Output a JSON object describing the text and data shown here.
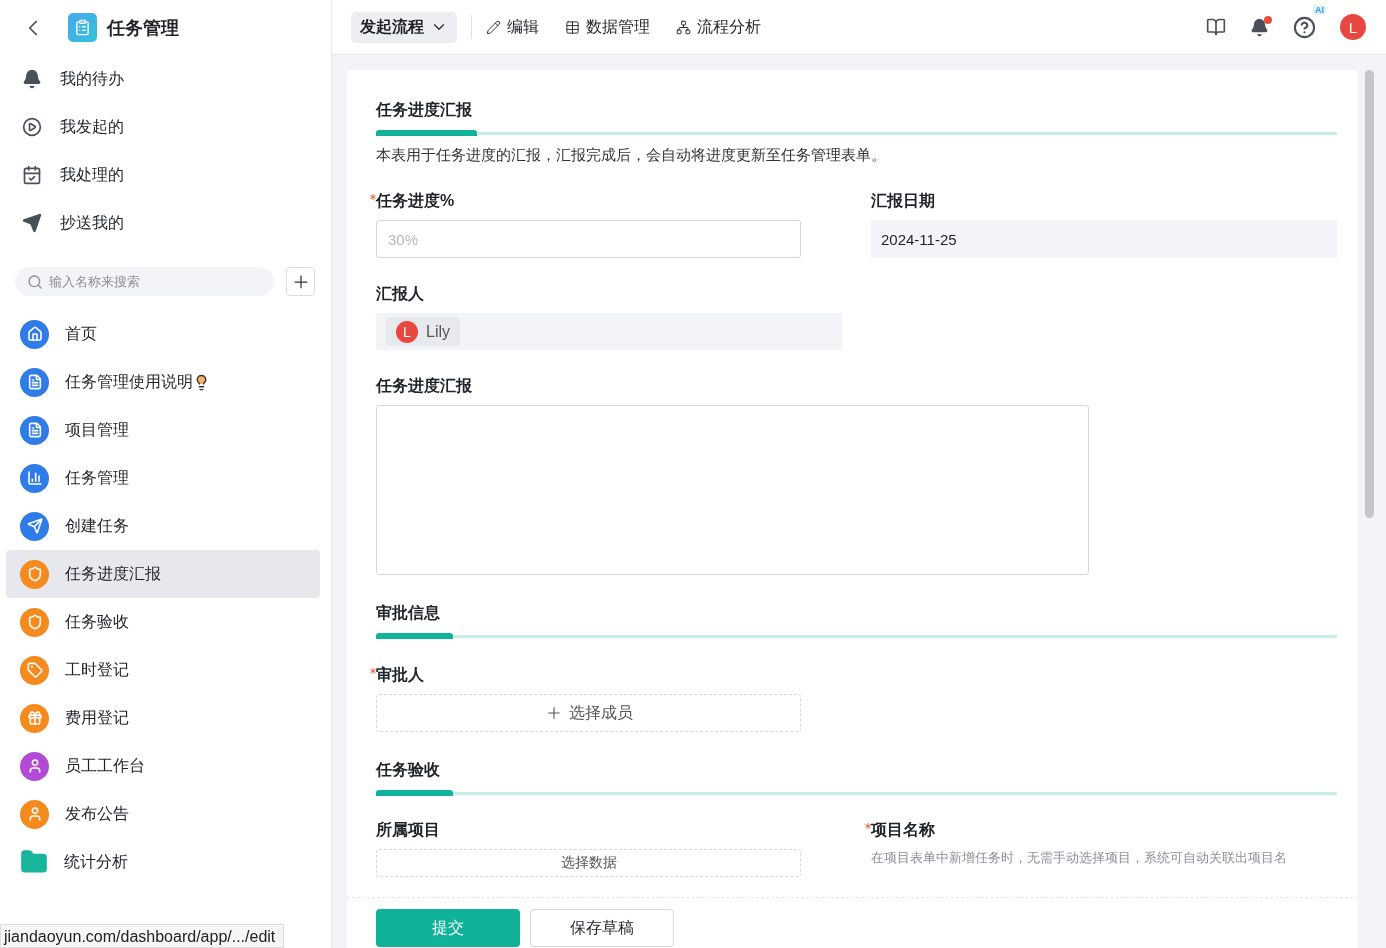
{
  "app": {
    "title": "任务管理"
  },
  "nav_top": [
    {
      "label": "我的待办",
      "kind": "bell"
    },
    {
      "label": "我发起的",
      "kind": "play"
    },
    {
      "label": "我处理的",
      "kind": "check"
    },
    {
      "label": "抄送我的",
      "kind": "send"
    }
  ],
  "search": {
    "placeholder": "输入名称来搜索"
  },
  "nav": [
    {
      "label": "首页",
      "kind": "home",
      "color": "#2f7be8",
      "selected": false
    },
    {
      "label": "任务管理使用说明",
      "kind": "doc",
      "color": "#2f7be8",
      "selected": false,
      "bulb": true
    },
    {
      "label": "项目管理",
      "kind": "doc",
      "color": "#2f7be8",
      "selected": false
    },
    {
      "label": "任务管理",
      "kind": "chart",
      "color": "#2f7be8",
      "selected": false
    },
    {
      "label": "创建任务",
      "kind": "send",
      "color": "#2f7be8",
      "selected": false
    },
    {
      "label": "任务进度汇报",
      "kind": "shield",
      "color": "#f58a1f",
      "selected": true
    },
    {
      "label": "任务验收",
      "kind": "shield",
      "color": "#f58a1f",
      "selected": false
    },
    {
      "label": "工时登记",
      "kind": "tag",
      "color": "#f58a1f",
      "selected": false
    },
    {
      "label": "费用登记",
      "kind": "gift",
      "color": "#f58a1f",
      "selected": false
    },
    {
      "label": "员工工作台",
      "kind": "person",
      "color": "#b24ad6",
      "selected": false
    },
    {
      "label": "发布公告",
      "kind": "person",
      "color": "#f58a1f",
      "selected": false
    },
    {
      "label": "统计分析",
      "kind": "folder",
      "color": "#16b59c",
      "selected": false
    }
  ],
  "toolbar": {
    "menu": "发起流程",
    "actions": [
      {
        "label": "编辑",
        "kind": "edit"
      },
      {
        "label": "数据管理",
        "kind": "table"
      },
      {
        "label": "流程分析",
        "kind": "flow"
      }
    ],
    "notification": true,
    "help_badge": "AI",
    "avatar": "L"
  },
  "form": {
    "title": "任务进度汇报",
    "description": "本表用于任务进度的汇报，汇报完成后，会自动将进度更新至任务管理表单。",
    "progress": {
      "label": "任务进度%",
      "required": true,
      "placeholder": "30%"
    },
    "date": {
      "label": "汇报日期",
      "required": false,
      "value": "2024-11-25"
    },
    "reporter": {
      "label": "汇报人",
      "avatar": "L",
      "name": "Lily"
    },
    "report": {
      "label": "任务进度汇报"
    },
    "approval": {
      "title": "审批信息",
      "label": "审批人",
      "required": true,
      "button": "选择成员"
    },
    "acceptance": {
      "title": "任务验收",
      "project_label": "所属项目",
      "project_button": "选择数据",
      "name_label": "项目名称",
      "name_required": true,
      "name_hint": "在项目表单中新增任务时，无需手动选择项目，系统可自动关联出项目名"
    }
  },
  "footer": {
    "buttons": [
      {
        "label": "提交",
        "kind": "primary"
      },
      {
        "label": "保存草稿",
        "kind": "secondary"
      }
    ]
  },
  "status_url": "jiandaoyun.com/dashboard/app/.../edit"
}
